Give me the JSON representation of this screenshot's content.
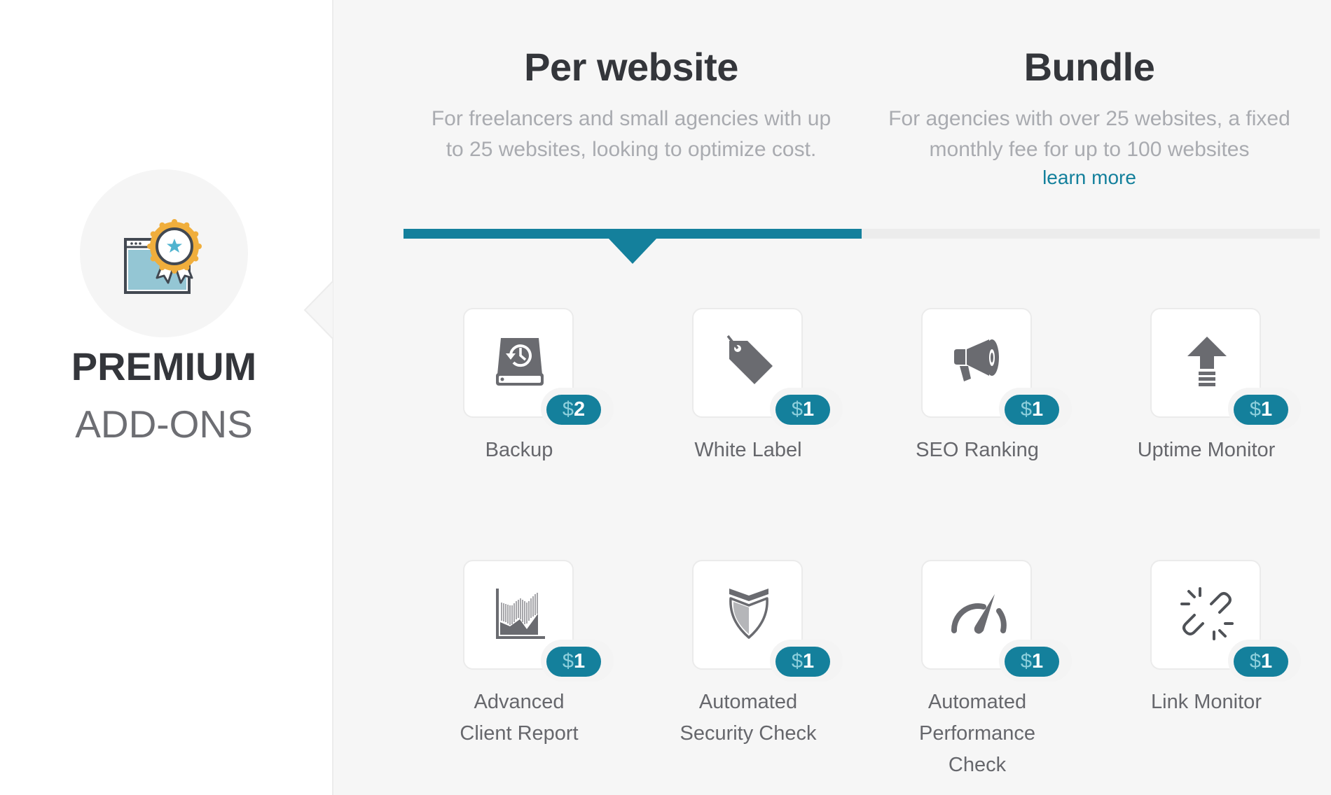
{
  "sidebar": {
    "icon": "premium-award-icon",
    "title": "PREMIUM",
    "subtitle": "ADD-ONS"
  },
  "plans": [
    {
      "title": "Per website",
      "description": "For freelancers and small agencies with up to 25 websites, looking to optimize cost.",
      "link": "",
      "active": true
    },
    {
      "title": "Bundle",
      "description": "For agencies with over 25 websites, a fixed monthly fee for up to 100 websites",
      "link": "learn more",
      "active": false
    }
  ],
  "colors": {
    "accent": "#14809c",
    "panel_bg": "#f6f6f6",
    "title": "#34363b",
    "muted": "#a9abb0",
    "icon": "#6a6b70"
  },
  "currency_symbol": "$",
  "addons": [
    {
      "label": "Backup",
      "price": "2",
      "icon": "backup-drive-icon"
    },
    {
      "label": "White Label",
      "price": "1",
      "icon": "tag-icon"
    },
    {
      "label": "SEO Ranking",
      "price": "1",
      "icon": "megaphone-icon"
    },
    {
      "label": "Uptime Monitor",
      "price": "1",
      "icon": "upload-arrow-icon"
    },
    {
      "label": "Advanced Client Report",
      "price": "1",
      "icon": "area-chart-icon"
    },
    {
      "label": "Automated Security Check",
      "price": "1",
      "icon": "shield-icon"
    },
    {
      "label": "Automated Performance Check",
      "price": "1",
      "icon": "speedometer-icon"
    },
    {
      "label": "Link Monitor",
      "price": "1",
      "icon": "broken-link-icon"
    }
  ]
}
